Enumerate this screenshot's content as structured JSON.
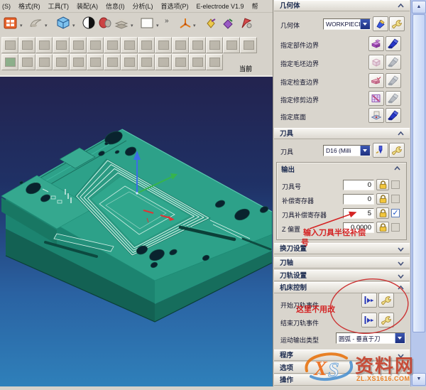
{
  "menu": {
    "items": [
      "(S)",
      "格式(R)",
      "工具(T)",
      "装配(A)",
      "信息(I)",
      "分析(L)",
      "首选项(P)",
      "E-electrode V1.9",
      "帮"
    ]
  },
  "toolbar": {
    "current_label": "当前",
    "gray_rows": [
      {
        "y": 52,
        "count": 15
      },
      {
        "y": 76,
        "count": 13
      }
    ]
  },
  "panel": {
    "geometry": {
      "header": "几何体",
      "row_label": "几何体",
      "workpiece": "WORKPIECE",
      "rows": [
        {
          "label": "指定部件边界"
        },
        {
          "label": "指定毛坯边界"
        },
        {
          "label": "指定检查边界"
        },
        {
          "label": "指定修剪边界"
        },
        {
          "label": "指定底面"
        }
      ]
    },
    "tool": {
      "header": "刀具",
      "row_label": "刀具",
      "value": "D16 (Milli"
    },
    "output": {
      "header": "输出",
      "fields": [
        {
          "label": "刀具号",
          "value": "0",
          "checked": false
        },
        {
          "label": "补偿寄存器",
          "value": "0",
          "checked": false
        },
        {
          "label": "刀具补偿寄存器",
          "value": "5",
          "checked": true
        },
        {
          "label": "Z 偏置",
          "value": "0.0000",
          "checked": false
        }
      ]
    },
    "bars": [
      {
        "label": "换刀设置"
      },
      {
        "label": "刀轴"
      },
      {
        "label": "刀轨设置"
      },
      {
        "label": "机床控制"
      }
    ],
    "machine": {
      "start_label": "开始刀轨事件",
      "end_label": "结束刀轨事件",
      "motion_label": "运动输出类型",
      "motion_value": "圆弧 - 垂直于刀"
    },
    "bottom_bars": [
      {
        "label": "程序"
      },
      {
        "label": "选项"
      },
      {
        "label": "操作"
      }
    ]
  },
  "annotations": {
    "radius_note_line1": "输入刀具半径补偿",
    "radius_note_line2": "号",
    "no_change_note": "这里不用改",
    "color": "#d42222"
  },
  "watermark": {
    "logo_text": "XS",
    "name": "资料网",
    "url": "ZL.XS1616.COM"
  },
  "colors": {
    "viewport_top": "#23234f",
    "viewport_bottom": "#2f80ba",
    "model_top": "#2da189",
    "accent_navy": "#1b3b8c",
    "annotation_red": "#d42222"
  }
}
